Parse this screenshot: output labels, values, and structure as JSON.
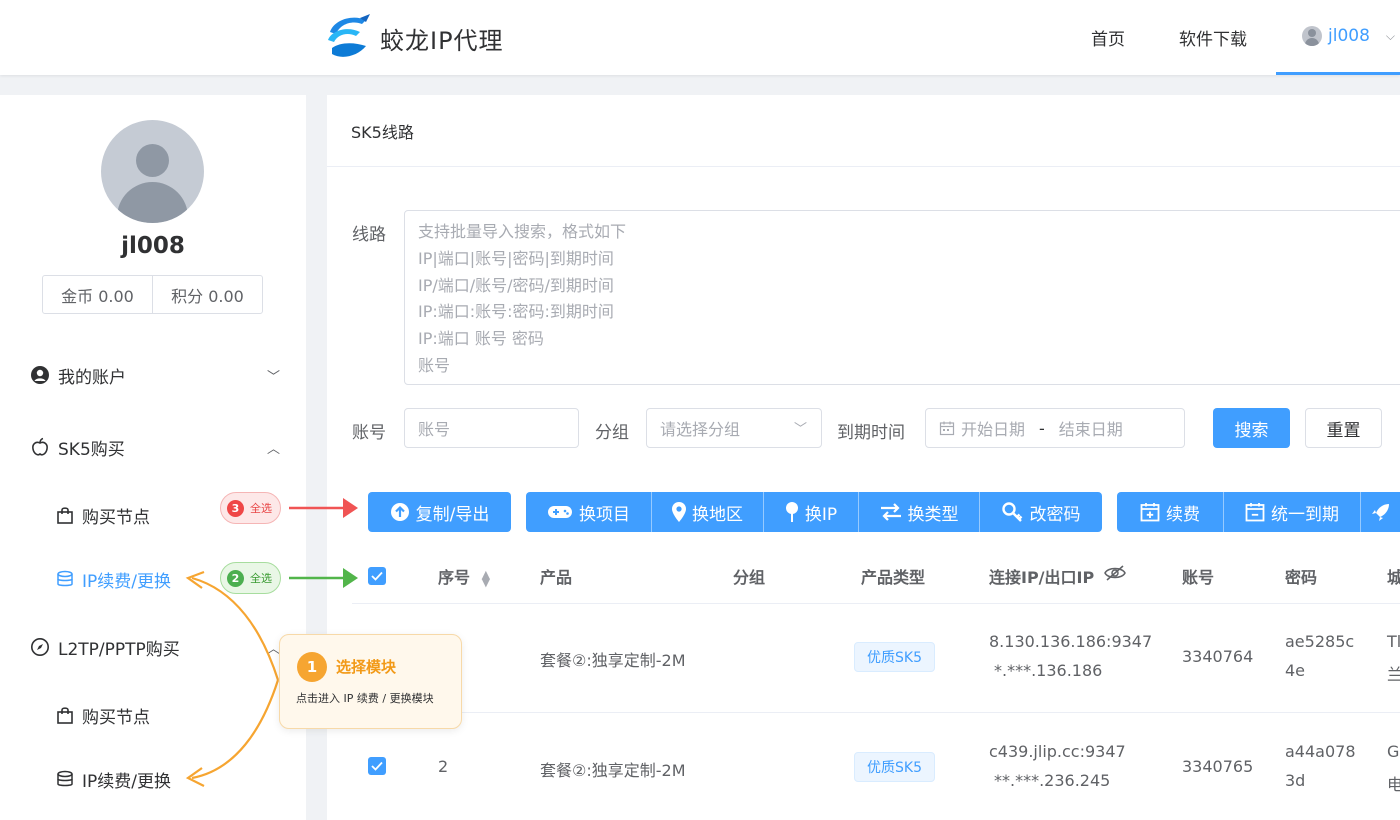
{
  "brand": {
    "name": "蛟龙IP代理"
  },
  "nav": {
    "home": "首页",
    "download": "软件下载",
    "user": "jl008"
  },
  "sidebar": {
    "username": "jl008",
    "coins": "金币 0.00",
    "points": "积分 0.00",
    "menu": [
      {
        "label": "我的账户"
      },
      {
        "label": "SK5购买"
      },
      {
        "label": "购买节点"
      },
      {
        "label": "IP续费/更换"
      },
      {
        "label": "L2TP/PPTP购买"
      },
      {
        "label": "购买节点"
      },
      {
        "label": "IP续费/更换"
      }
    ],
    "badges": [
      {
        "num": "3",
        "text": "全选"
      },
      {
        "num": "2",
        "text": "全选"
      }
    ]
  },
  "tooltip": {
    "num": "1",
    "title": "选择模块",
    "desc": "点击进入 IP 续费 / 更换模块"
  },
  "main": {
    "title": "SK5线路",
    "form": {
      "line_label": "线路",
      "line_placeholder_lines": [
        "支持批量导入搜索，格式如下",
        "IP|端口|账号|密码|到期时间",
        "IP/端口/账号/密码/到期时间",
        "IP:端口:账号:密码:到期时间",
        "IP:端口 账号 密码",
        "账号"
      ],
      "account_label": "账号",
      "account_placeholder": "账号",
      "group_label": "分组",
      "group_placeholder": "请选择分组",
      "expire_label": "到期时间",
      "start_placeholder": "开始日期",
      "range_sep": "-",
      "end_placeholder": "结束日期",
      "search": "搜索",
      "reset": "重置"
    },
    "toolbar": {
      "copy_export": "复制/导出",
      "change_project": "换项目",
      "change_region": "换地区",
      "change_ip": "换IP",
      "change_type": "换类型",
      "change_password": "改密码",
      "renew": "续费",
      "unify_expire": "统一到期"
    },
    "table": {
      "headers": {
        "index": "序号",
        "product": "产品",
        "group": "分组",
        "type": "产品类型",
        "ip": "连接IP/出口IP",
        "account": "账号",
        "password": "密码",
        "city": "城"
      },
      "rows": [
        {
          "index": "",
          "product": "套餐②:独享定制-2M",
          "type": "优质SK5",
          "ip1": "8.130.136.186:9347",
          "ip2": "*.***.136.186",
          "account": "3340764",
          "pw1": "ae5285c",
          "pw2": "4e",
          "city1": "Tl",
          "city2": "兰"
        },
        {
          "index": "2",
          "product": "套餐②:独享定制-2M",
          "type": "优质SK5",
          "ip1": "c439.jlip.cc:9347",
          "ip2": "**.***.236.245",
          "account": "3340765",
          "pw1": "a44a078",
          "pw2": "3d",
          "city1": "G",
          "city2": "电"
        }
      ]
    }
  },
  "colors": {
    "primary": "#409eff",
    "red_arrow": "#f05454",
    "green_arrow": "#52b54a",
    "orange": "#f6a531"
  }
}
